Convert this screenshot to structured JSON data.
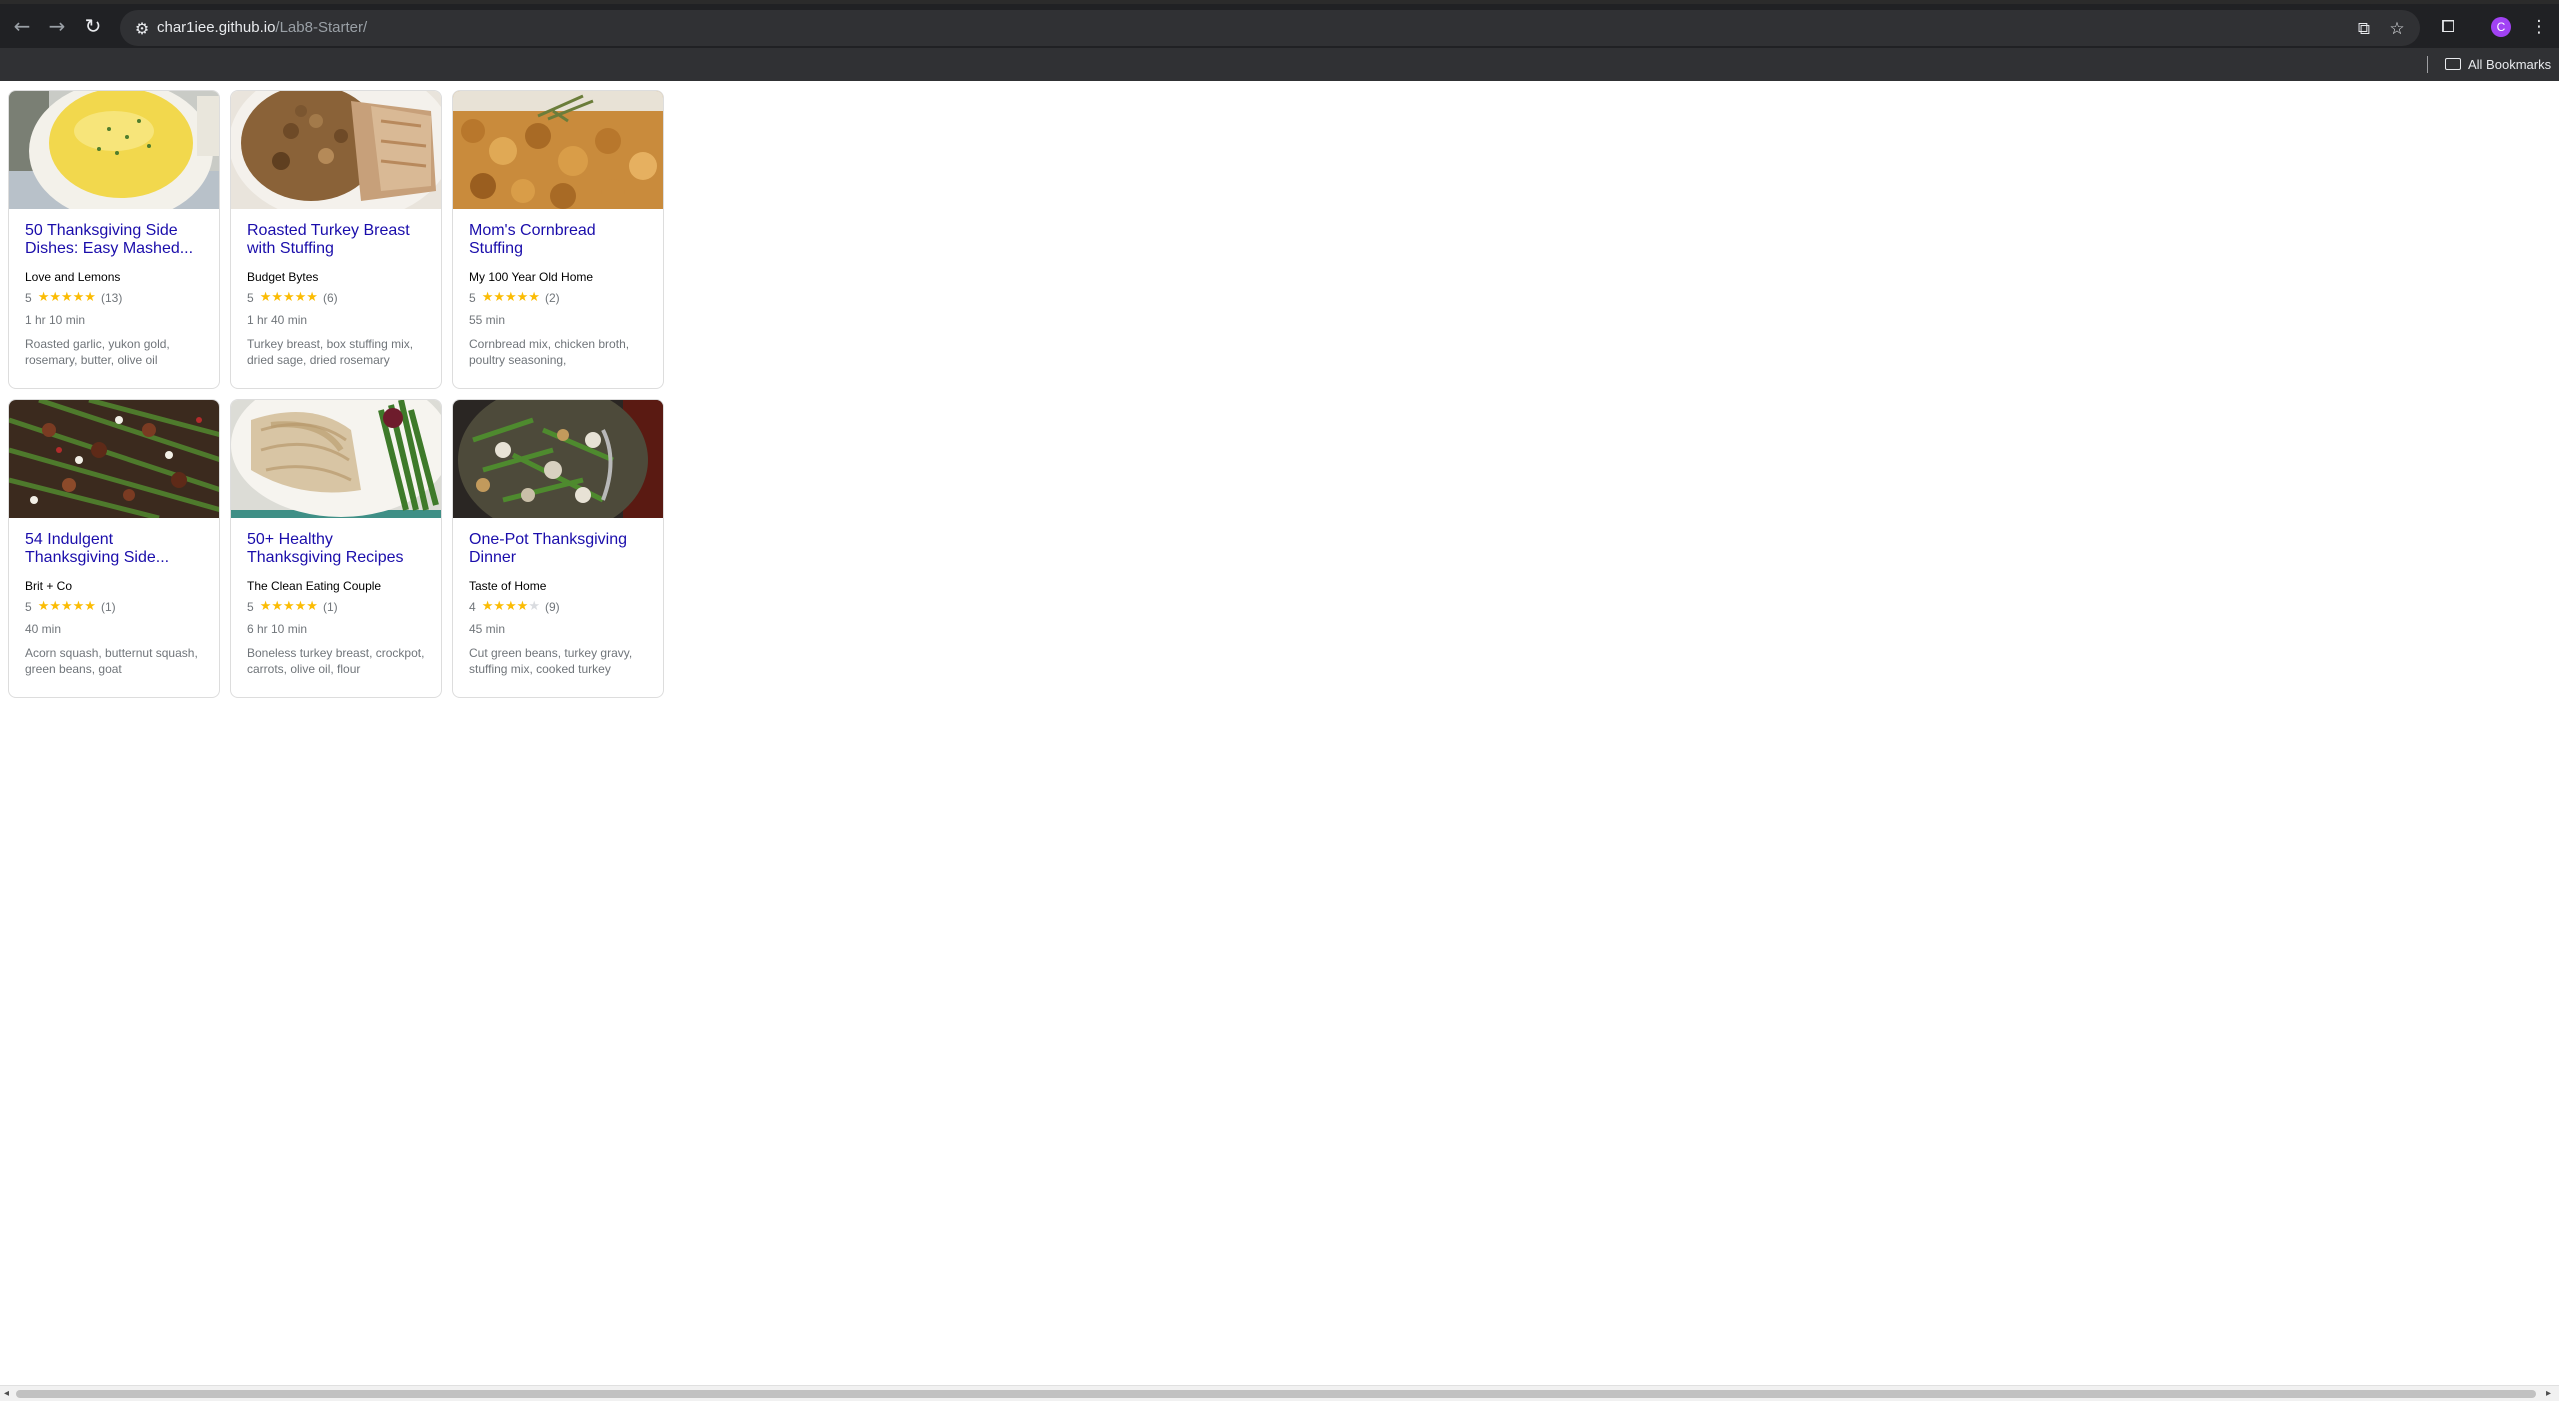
{
  "browser": {
    "url_host": "char1iee.github.io",
    "url_path": "/Lab8-Starter/",
    "avatar_letter": "C",
    "bookmarks_label": "All Bookmarks"
  },
  "recipes": [
    {
      "title": "50 Thanksgiving Side Dishes: Easy Mashed...",
      "org": "Love and Lemons",
      "rating": 5,
      "rating_label": "5",
      "stars": "★★★★★",
      "empty_stars": "",
      "reviews": "(13)",
      "time": "1 hr 10 min",
      "ingredients": "Roasted garlic, yukon gold, rosemary, butter, olive oil",
      "image_desc": "mashed-potatoes"
    },
    {
      "title": "Roasted Turkey Breast with Stuffing",
      "org": "Budget Bytes",
      "rating": 5,
      "rating_label": "5",
      "stars": "★★★★★",
      "empty_stars": "",
      "reviews": "(6)",
      "time": "1 hr 40 min",
      "ingredients": "Turkey breast, box stuffing mix, dried sage, dried rosemary",
      "image_desc": "turkey-stuffing"
    },
    {
      "title": "Mom's Cornbread Stuffing",
      "org": "My 100 Year Old Home",
      "rating": 5,
      "rating_label": "5",
      "stars": "★★★★★",
      "empty_stars": "",
      "reviews": "(2)",
      "time": "55 min",
      "ingredients": "Cornbread mix, chicken broth, poultry seasoning,",
      "image_desc": "cornbread-stuffing"
    },
    {
      "title": "54 Indulgent Thanksgiving Side...",
      "org": "Brit + Co",
      "rating": 5,
      "rating_label": "5",
      "stars": "★★★★★",
      "empty_stars": "",
      "reviews": "(1)",
      "time": "40 min",
      "ingredients": "Acorn squash, butternut squash, green beans, goat",
      "image_desc": "green-beans-pecans"
    },
    {
      "title": "50+ Healthy Thanksgiving Recipes",
      "org": "The Clean Eating Couple",
      "rating": 5,
      "rating_label": "5",
      "stars": "★★★★★",
      "empty_stars": "",
      "reviews": "(1)",
      "time": "6 hr 10 min",
      "ingredients": "Boneless turkey breast, crockpot, carrots, olive oil, flour",
      "image_desc": "sliced-turkey-green-beans"
    },
    {
      "title": "One-Pot Thanksgiving Dinner",
      "org": "Taste of Home",
      "rating": 4,
      "rating_label": "4",
      "stars": "★★★★",
      "empty_stars": "★",
      "reviews": "(9)",
      "time": "45 min",
      "ingredients": "Cut green beans, turkey gravy, stuffing mix, cooked turkey",
      "image_desc": "one-pot-dinner"
    }
  ],
  "colors": {
    "link": "#1a0dab",
    "star": "#fbbc04",
    "muted": "#70757a"
  }
}
